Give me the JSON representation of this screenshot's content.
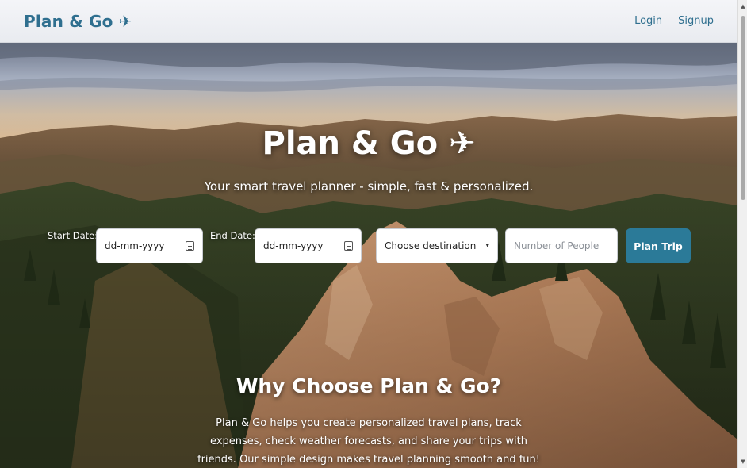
{
  "navbar": {
    "brand": "Plan & Go ✈",
    "links": [
      "Login",
      "Signup"
    ]
  },
  "hero": {
    "title": "Plan & Go ✈",
    "subtitle": "Your smart travel planner - simple, fast & personalized."
  },
  "form": {
    "start_label": "Start Date:",
    "start_value": "dd-mm-yyyy",
    "end_label": "End Date:",
    "end_value": "dd-mm-yyyy",
    "destination_value": "Choose destination",
    "people_placeholder": "Number of People",
    "submit_label": "Plan Trip"
  },
  "why": {
    "title": "Why Choose Plan & Go?",
    "text": "Plan & Go helps you create personalized travel plans, track expenses, check weather forecasts, and share your trips with friends. Our simple design makes travel planning smooth and fun!"
  },
  "colors": {
    "brand": "#2f6f8f",
    "button": "#2b7a98"
  }
}
